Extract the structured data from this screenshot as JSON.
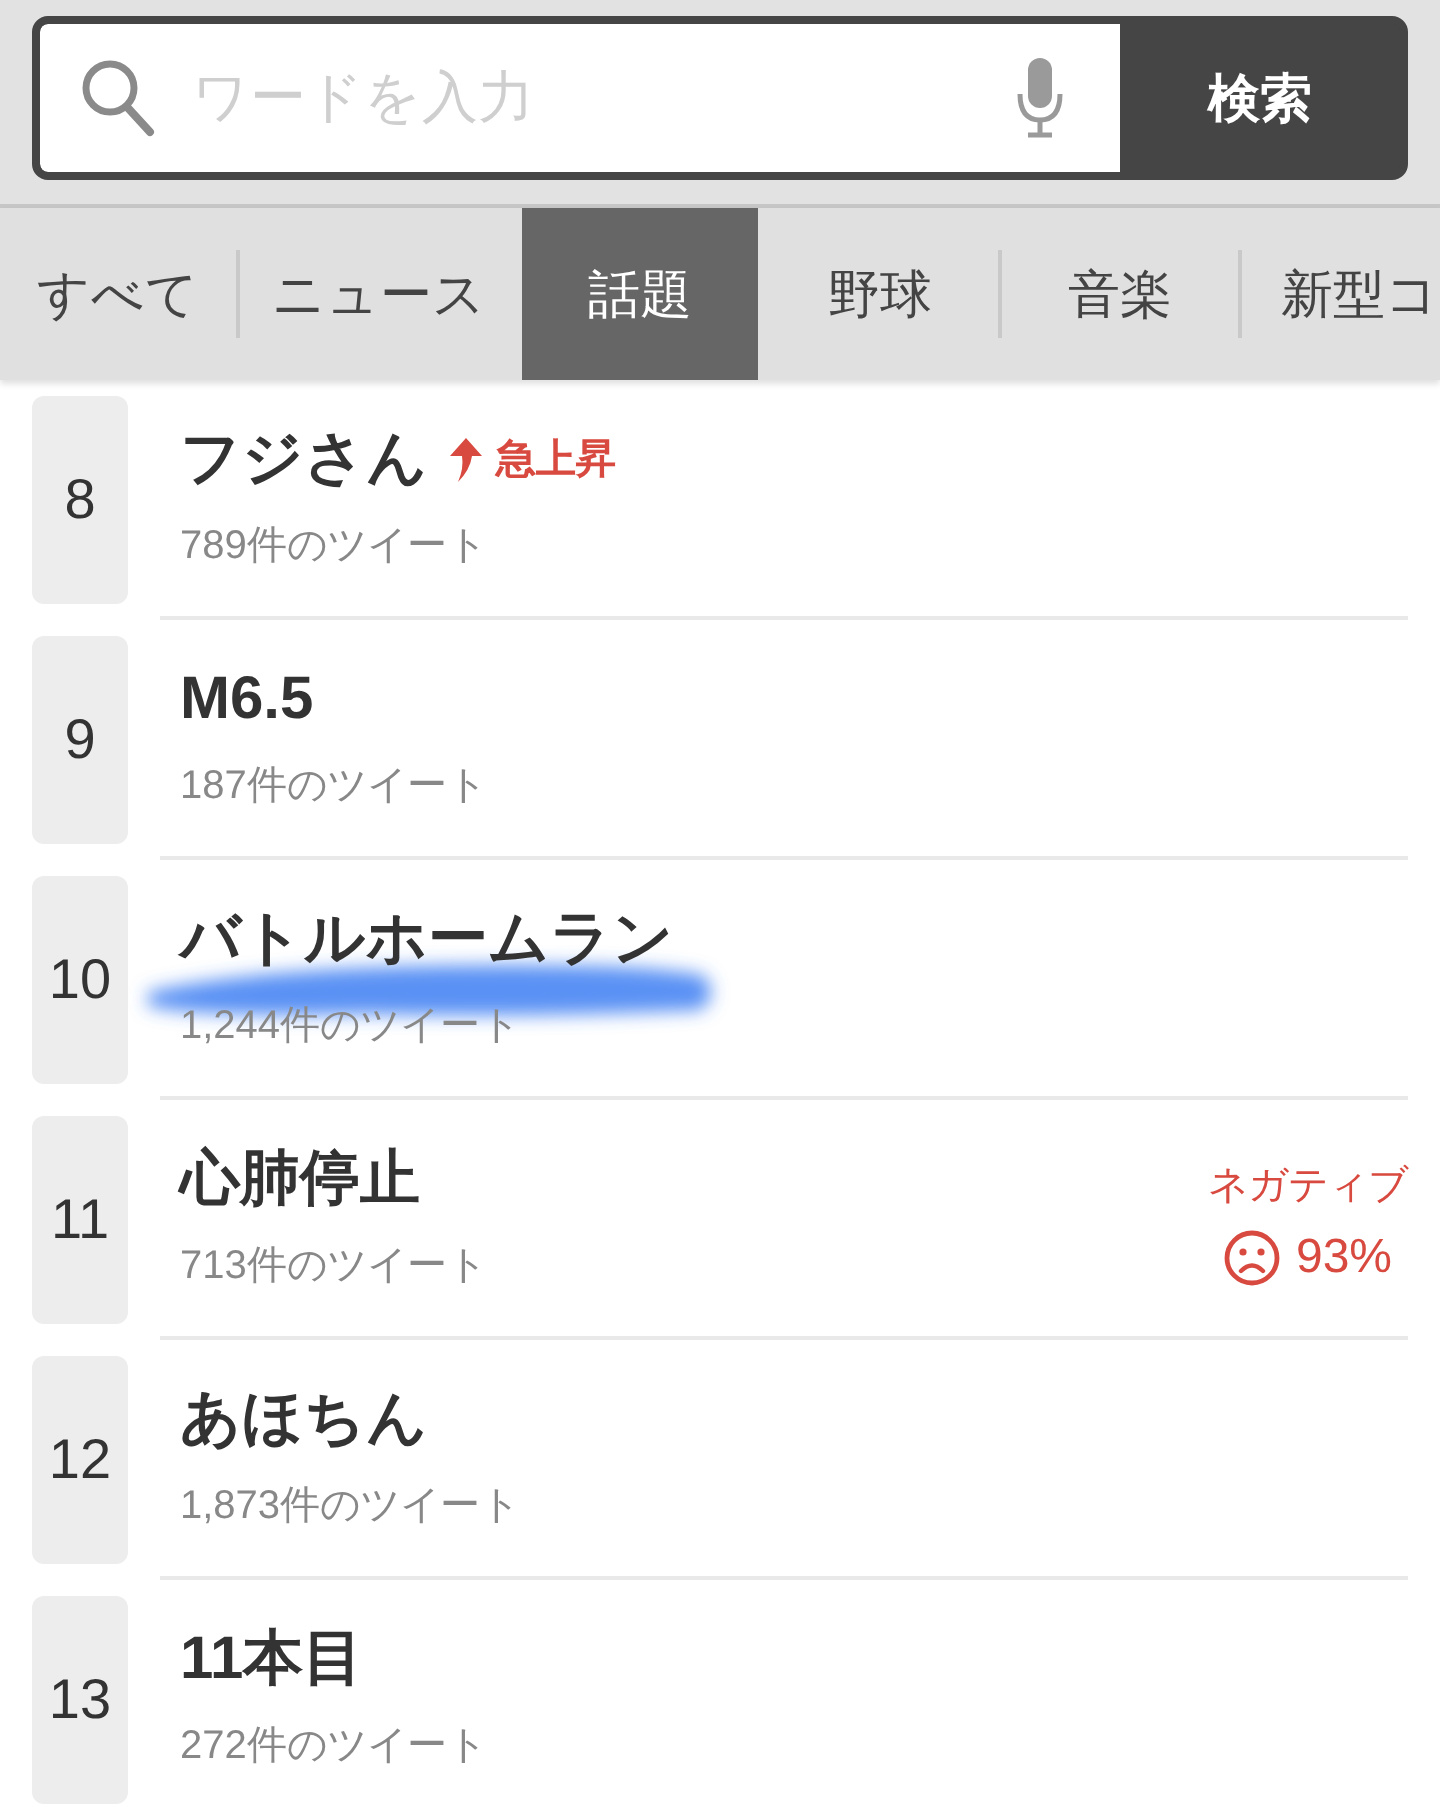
{
  "search": {
    "placeholder": "ワードを入力",
    "button": "検索"
  },
  "tabs": [
    {
      "label": "すべて",
      "selected": false
    },
    {
      "label": "ニュース",
      "selected": false
    },
    {
      "label": "話題",
      "selected": true
    },
    {
      "label": "野球",
      "selected": false
    },
    {
      "label": "音楽",
      "selected": false
    },
    {
      "label": "新型コ",
      "selected": false
    }
  ],
  "trends": [
    {
      "rank": "8",
      "title": "フジさん",
      "tweets": "789件のツイート",
      "highlighted": false,
      "badge": {
        "label": "急上昇"
      }
    },
    {
      "rank": "9",
      "title": "M6.5",
      "tweets": "187件のツイート",
      "highlighted": false
    },
    {
      "rank": "10",
      "title": "バトルホームラン",
      "tweets": "1,244件のツイート",
      "highlighted": true
    },
    {
      "rank": "11",
      "title": "心肺停止",
      "tweets": "713件のツイート",
      "highlighted": false,
      "sentiment": {
        "kind": "negative",
        "label": "ネガティブ",
        "value": "93%"
      }
    },
    {
      "rank": "12",
      "title": "あほちん",
      "tweets": "1,873件のツイート",
      "highlighted": false
    },
    {
      "rank": "13",
      "title": "11本目",
      "tweets": "272件のツイート",
      "highlighted": false
    }
  ]
}
